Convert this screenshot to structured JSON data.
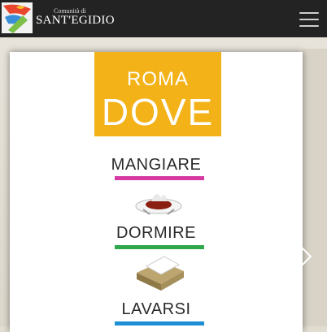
{
  "header": {
    "logo_small": "Comunità di",
    "logo_big": "SANT'EGIDIO",
    "menu_icon": "hamburger-menu-icon"
  },
  "slide": {
    "title_top": "ROMA",
    "title_main": "DOVE",
    "title_bg": "#f3b218",
    "categories": [
      {
        "label": "MANGIARE",
        "color": "#d63aa2",
        "icon": "food-plate-icon"
      },
      {
        "label": "DORMIRE",
        "color": "#2ea84b",
        "icon": "bed-pillow-icon"
      },
      {
        "label": "LAVARSI",
        "color": "#1d8fd6",
        "icon": "wash-icon"
      }
    ]
  },
  "carousel": {
    "prev_icon": "chevron-left-icon",
    "next_icon": "chevron-right-icon"
  }
}
